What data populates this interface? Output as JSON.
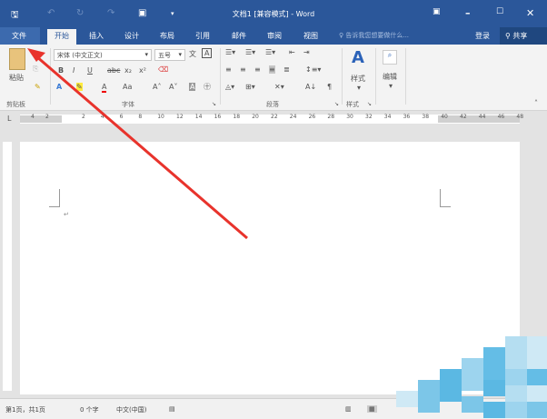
{
  "window": {
    "title": "文档1 [兼容模式] - Word"
  },
  "tabs": [
    {
      "label": "文件"
    },
    {
      "label": "开始"
    },
    {
      "label": "插入"
    },
    {
      "label": "设计"
    },
    {
      "label": "布局"
    },
    {
      "label": "引用"
    },
    {
      "label": "邮件"
    },
    {
      "label": "审阅"
    },
    {
      "label": "视图"
    }
  ],
  "tell_me": "告诉我您想要做什么...",
  "login": "登录",
  "share": "共享",
  "ribbon": {
    "paste": "粘贴",
    "clipboard_group": "剪贴板",
    "font_name": "宋体 (中文正文)",
    "font_size": "五号",
    "font_group": "字体",
    "paragraph_group": "段落",
    "styles": "样式",
    "styles_group": "样式",
    "editing": "编辑",
    "font_buttons": [
      "B",
      "I",
      "U",
      "abc",
      "x₂",
      "x²"
    ],
    "font_buttons2": [
      "A",
      "A",
      "Aa",
      "A˄",
      "A˅"
    ]
  },
  "ruler": {
    "ticks": [
      "4",
      "2",
      "2",
      "4",
      "6",
      "8",
      "10",
      "12",
      "14",
      "16",
      "18",
      "20",
      "22",
      "24",
      "26",
      "28",
      "30",
      "32",
      "34",
      "36",
      "38",
      "40",
      "42",
      "44",
      "46",
      "48"
    ]
  },
  "status": {
    "page": "第1页，共1页",
    "words": "0 个字",
    "language": "中文(中国)"
  },
  "colors": {
    "brand": "#2b579a",
    "arrow": "#e8332c"
  }
}
